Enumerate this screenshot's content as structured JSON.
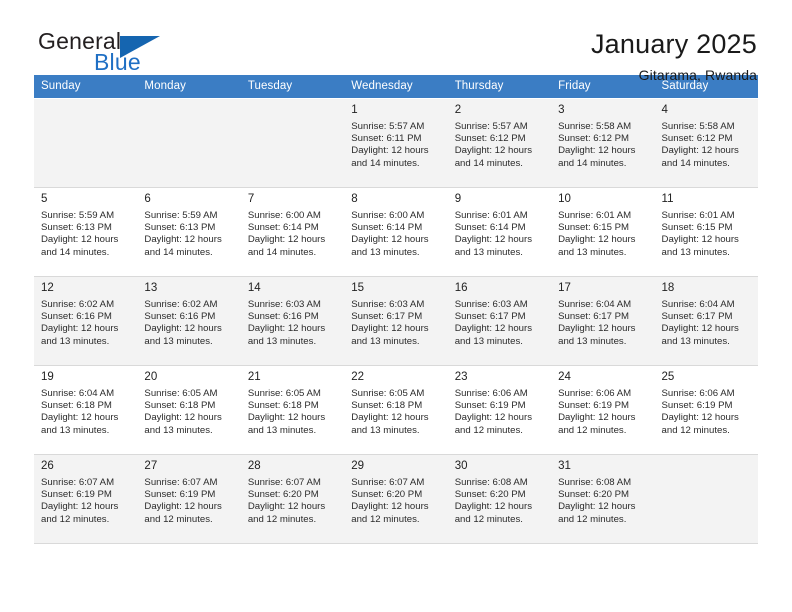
{
  "brand": {
    "name_top": "General",
    "name_bottom": "Blue",
    "accent_color": "#1565b0",
    "text_color": "#231f20"
  },
  "header": {
    "title": "January 2025",
    "subtitle": "Gitarama, Rwanda"
  },
  "theme": {
    "header_row_bg": "#3b7dc4",
    "header_row_text": "#ffffff",
    "alt_row_bg": "#f3f3f3",
    "row_bg": "#ffffff",
    "grid_line": "#d9d9d9"
  },
  "weekday_headers": [
    "Sunday",
    "Monday",
    "Tuesday",
    "Wednesday",
    "Thursday",
    "Friday",
    "Saturday"
  ],
  "weeks": [
    [
      {
        "day": "",
        "info": ""
      },
      {
        "day": "",
        "info": ""
      },
      {
        "day": "",
        "info": ""
      },
      {
        "day": "1",
        "info": "Sunrise: 5:57 AM\nSunset: 6:11 PM\nDaylight: 12 hours\nand 14 minutes."
      },
      {
        "day": "2",
        "info": "Sunrise: 5:57 AM\nSunset: 6:12 PM\nDaylight: 12 hours\nand 14 minutes."
      },
      {
        "day": "3",
        "info": "Sunrise: 5:58 AM\nSunset: 6:12 PM\nDaylight: 12 hours\nand 14 minutes."
      },
      {
        "day": "4",
        "info": "Sunrise: 5:58 AM\nSunset: 6:12 PM\nDaylight: 12 hours\nand 14 minutes."
      }
    ],
    [
      {
        "day": "5",
        "info": "Sunrise: 5:59 AM\nSunset: 6:13 PM\nDaylight: 12 hours\nand 14 minutes."
      },
      {
        "day": "6",
        "info": "Sunrise: 5:59 AM\nSunset: 6:13 PM\nDaylight: 12 hours\nand 14 minutes."
      },
      {
        "day": "7",
        "info": "Sunrise: 6:00 AM\nSunset: 6:14 PM\nDaylight: 12 hours\nand 14 minutes."
      },
      {
        "day": "8",
        "info": "Sunrise: 6:00 AM\nSunset: 6:14 PM\nDaylight: 12 hours\nand 13 minutes."
      },
      {
        "day": "9",
        "info": "Sunrise: 6:01 AM\nSunset: 6:14 PM\nDaylight: 12 hours\nand 13 minutes."
      },
      {
        "day": "10",
        "info": "Sunrise: 6:01 AM\nSunset: 6:15 PM\nDaylight: 12 hours\nand 13 minutes."
      },
      {
        "day": "11",
        "info": "Sunrise: 6:01 AM\nSunset: 6:15 PM\nDaylight: 12 hours\nand 13 minutes."
      }
    ],
    [
      {
        "day": "12",
        "info": "Sunrise: 6:02 AM\nSunset: 6:16 PM\nDaylight: 12 hours\nand 13 minutes."
      },
      {
        "day": "13",
        "info": "Sunrise: 6:02 AM\nSunset: 6:16 PM\nDaylight: 12 hours\nand 13 minutes."
      },
      {
        "day": "14",
        "info": "Sunrise: 6:03 AM\nSunset: 6:16 PM\nDaylight: 12 hours\nand 13 minutes."
      },
      {
        "day": "15",
        "info": "Sunrise: 6:03 AM\nSunset: 6:17 PM\nDaylight: 12 hours\nand 13 minutes."
      },
      {
        "day": "16",
        "info": "Sunrise: 6:03 AM\nSunset: 6:17 PM\nDaylight: 12 hours\nand 13 minutes."
      },
      {
        "day": "17",
        "info": "Sunrise: 6:04 AM\nSunset: 6:17 PM\nDaylight: 12 hours\nand 13 minutes."
      },
      {
        "day": "18",
        "info": "Sunrise: 6:04 AM\nSunset: 6:17 PM\nDaylight: 12 hours\nand 13 minutes."
      }
    ],
    [
      {
        "day": "19",
        "info": "Sunrise: 6:04 AM\nSunset: 6:18 PM\nDaylight: 12 hours\nand 13 minutes."
      },
      {
        "day": "20",
        "info": "Sunrise: 6:05 AM\nSunset: 6:18 PM\nDaylight: 12 hours\nand 13 minutes."
      },
      {
        "day": "21",
        "info": "Sunrise: 6:05 AM\nSunset: 6:18 PM\nDaylight: 12 hours\nand 13 minutes."
      },
      {
        "day": "22",
        "info": "Sunrise: 6:05 AM\nSunset: 6:18 PM\nDaylight: 12 hours\nand 13 minutes."
      },
      {
        "day": "23",
        "info": "Sunrise: 6:06 AM\nSunset: 6:19 PM\nDaylight: 12 hours\nand 12 minutes."
      },
      {
        "day": "24",
        "info": "Sunrise: 6:06 AM\nSunset: 6:19 PM\nDaylight: 12 hours\nand 12 minutes."
      },
      {
        "day": "25",
        "info": "Sunrise: 6:06 AM\nSunset: 6:19 PM\nDaylight: 12 hours\nand 12 minutes."
      }
    ],
    [
      {
        "day": "26",
        "info": "Sunrise: 6:07 AM\nSunset: 6:19 PM\nDaylight: 12 hours\nand 12 minutes."
      },
      {
        "day": "27",
        "info": "Sunrise: 6:07 AM\nSunset: 6:19 PM\nDaylight: 12 hours\nand 12 minutes."
      },
      {
        "day": "28",
        "info": "Sunrise: 6:07 AM\nSunset: 6:20 PM\nDaylight: 12 hours\nand 12 minutes."
      },
      {
        "day": "29",
        "info": "Sunrise: 6:07 AM\nSunset: 6:20 PM\nDaylight: 12 hours\nand 12 minutes."
      },
      {
        "day": "30",
        "info": "Sunrise: 6:08 AM\nSunset: 6:20 PM\nDaylight: 12 hours\nand 12 minutes."
      },
      {
        "day": "31",
        "info": "Sunrise: 6:08 AM\nSunset: 6:20 PM\nDaylight: 12 hours\nand 12 minutes."
      },
      {
        "day": "",
        "info": ""
      }
    ]
  ]
}
